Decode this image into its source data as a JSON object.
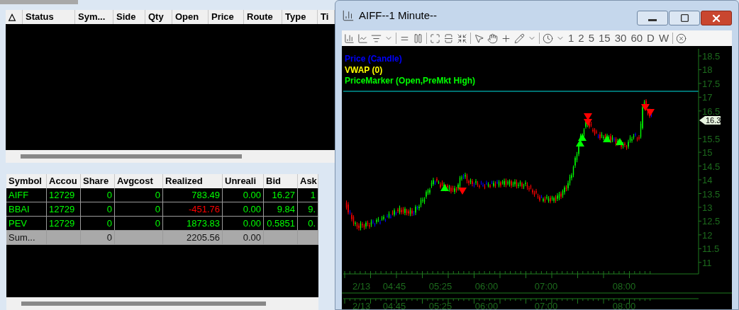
{
  "orders_table": {
    "columns": [
      "△",
      "Status",
      "Sym...",
      "Side",
      "Qty",
      "Open",
      "Price",
      "Route",
      "Type",
      "Ti"
    ]
  },
  "positions_table": {
    "columns": [
      "Symbol",
      "Accou",
      "Share",
      "Avgcost",
      "Realized",
      "Unreali",
      "Bid",
      "Ask"
    ],
    "rows": [
      {
        "kind": "position",
        "realized_negative": false,
        "cells": [
          "AIFF",
          "12729",
          "0",
          "0",
          "783.49",
          "0.00",
          "16.27",
          "1"
        ]
      },
      {
        "kind": "position",
        "realized_negative": true,
        "cells": [
          "BBAI",
          "12729",
          "0",
          "0",
          "-451.76",
          "0.00",
          "9.84",
          "9."
        ]
      },
      {
        "kind": "position",
        "realized_negative": false,
        "cells": [
          "PEV",
          "12729",
          "0",
          "0",
          "1873.83",
          "0.00",
          "0.5851",
          "0."
        ]
      },
      {
        "kind": "summary",
        "realized_negative": false,
        "cells": [
          "Sum...",
          "",
          "0",
          "",
          "2205.56",
          "0.00",
          "",
          ""
        ]
      }
    ]
  },
  "chart_window": {
    "title": "AIFF--1 Minute--",
    "intervals": [
      "1",
      "2",
      "5",
      "15",
      "30",
      "60",
      "D",
      "W"
    ],
    "legend": [
      {
        "label": "Price (Candle)",
        "color": "#0000ff"
      },
      {
        "label": "VWAP (0)",
        "color": "#ffff00"
      },
      {
        "label": "PriceMarker (Open,PreMkt High)",
        "color": "#00ff00"
      }
    ],
    "price_axis": [
      "18.5",
      "18",
      "17.5",
      "17",
      "16.5",
      "15.5",
      "15",
      "14.5",
      "14",
      "13.5",
      "13",
      "12.5",
      "12",
      "11.5",
      "11"
    ],
    "last_price": "16.3",
    "time_axis": [
      "2/13",
      "04:45",
      "05:25",
      "06:00",
      "07:00",
      "08:00"
    ],
    "lower_time_axis": [
      "2/13",
      "04:45",
      "05:25",
      "06:00",
      "07:00",
      "08:00"
    ]
  }
}
